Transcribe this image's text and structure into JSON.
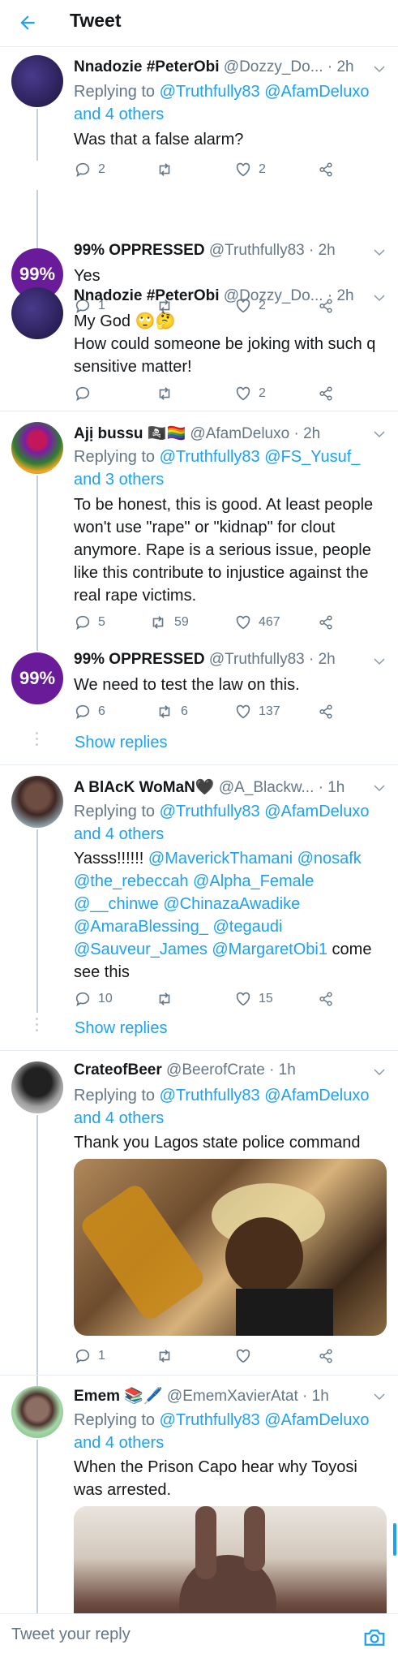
{
  "header": {
    "title": "Tweet"
  },
  "actions_icons": {
    "reply": "reply-icon",
    "retweet": "retweet-icon",
    "like": "heart-icon",
    "share": "share-icon"
  },
  "tweets": [
    {
      "name": "Nnadozie #PeterObi",
      "handle": "@Dozzy_Do...",
      "time": "· 2h",
      "replying_prefix": "Replying to",
      "replying_users": "@Truthfully83 @AfamDeluxo",
      "replying_others": "and 4 others",
      "text": "Was that a false alarm?",
      "replies": "2",
      "retweets": "",
      "likes": "2"
    },
    {
      "name": "99% OPPRESSED",
      "handle": "@Truthfully83",
      "time": "· 2h",
      "avatar_text": "99%",
      "text": "Yes",
      "replies": "1",
      "retweets": "",
      "likes": "2"
    },
    {
      "name": "Nnadozie #PeterObi",
      "handle": "@Dozzy_Do...",
      "time": "· 2h",
      "text_line1": "My God 🙄🤔",
      "text_line2": "How could someone be joking with such q sensitive matter!",
      "replies": "",
      "retweets": "",
      "likes": "2"
    },
    {
      "name": "Ajị bussu",
      "name_emoji": "🏴‍☠️🏳️‍🌈",
      "handle": "@AfamDeluxo",
      "time": "· 2h",
      "replying_prefix": "Replying to",
      "replying_users": "@Truthfully83 @FS_Yusuf_",
      "replying_others": "and 3 others",
      "text": "To be honest, this is good.  At least people won't use \"rape\" or \"kidnap\" for clout anymore.  Rape is a serious issue, people like this contribute to injustice against the real rape victims.",
      "replies": "5",
      "retweets": "59",
      "likes": "467"
    },
    {
      "name": "99% OPPRESSED",
      "handle": "@Truthfully83",
      "time": "· 2h",
      "avatar_text": "99%",
      "text": "We need to test the law on this.",
      "replies": "6",
      "retweets": "6",
      "likes": "137",
      "show_replies": "Show replies"
    },
    {
      "name": "A BlAcK WoMaN🖤",
      "handle": "@A_Blackw...",
      "time": "· 1h",
      "replying_prefix": "Replying to",
      "replying_users": "@Truthfully83 @AfamDeluxo",
      "replying_others": "and 4 others",
      "text_plain": "Yasss!!!!!!",
      "mentions": "@MaverickThamani @nosafk @the_rebeccah @Alpha_Female @__chinwe @ChinazaAwadike @AmaraBlessing_ @tegaudi @Sauveur_James @MargaretObi1",
      "text_tail": "come see this",
      "replies": "10",
      "retweets": "",
      "likes": "15",
      "show_replies": "Show replies"
    },
    {
      "name": "CrateofBeer",
      "handle": "@BeerofCrate",
      "time": "· 1h",
      "replying_prefix": "Replying to",
      "replying_users": "@Truthfully83 @AfamDeluxo",
      "replying_others": "and 4 others",
      "text": "Thank you Lagos state police command",
      "replies": "1",
      "retweets": "",
      "likes": ""
    },
    {
      "name": "Emem",
      "name_emoji": "📚🖊️",
      "handle": "@EmemXavierAtat",
      "time": "· 1h",
      "replying_prefix": "Replying to",
      "replying_users": "@Truthfully83 @AfamDeluxo",
      "replying_others": "and 4 others",
      "text": "When the Prison Capo hear why Toyosi was arrested."
    }
  ],
  "reply_bar": {
    "placeholder": "Tweet your reply",
    "camera": "camera-icon"
  }
}
